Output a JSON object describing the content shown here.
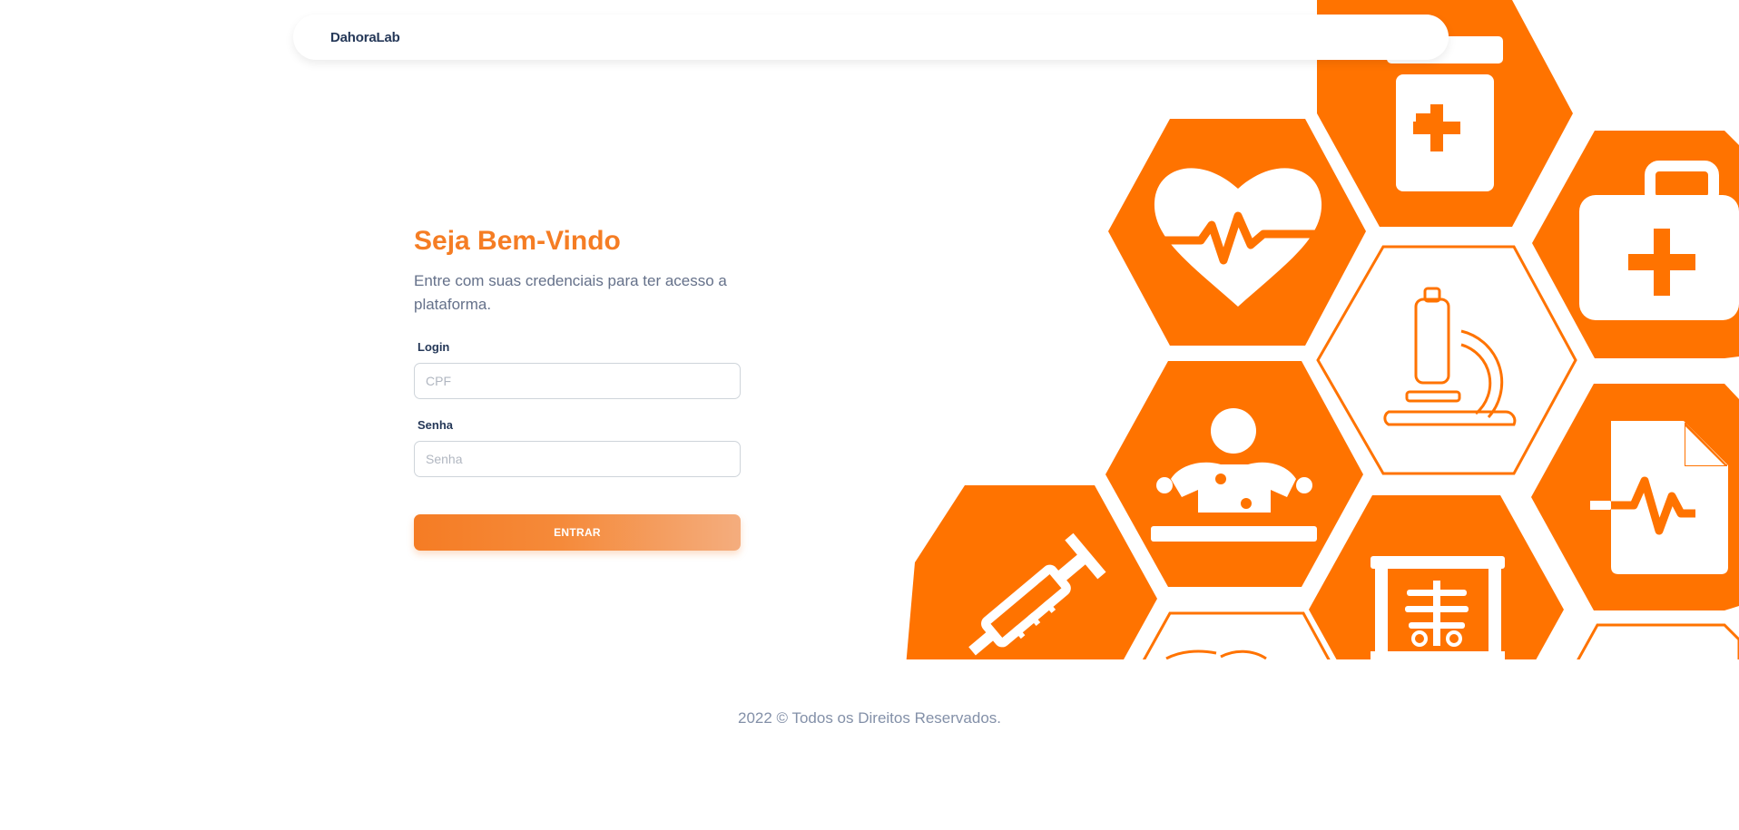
{
  "header": {
    "brand": "DahoraLab"
  },
  "login": {
    "title": "Seja Bem-Vindo",
    "subtitle": "Entre com suas credenciais para ter acesso a plataforma.",
    "login_label": "Login",
    "login_placeholder": "CPF",
    "password_label": "Senha",
    "password_placeholder": "Senha",
    "submit_label": "ENTRAR"
  },
  "footer": {
    "text": "2022 © Todos os Direitos Reservados."
  },
  "illustration": {
    "icons": [
      "heart-pulse-icon",
      "medicine-bottle-icon",
      "first-aid-kit-icon",
      "microscope-icon",
      "patient-bed-icon",
      "document-pulse-icon",
      "syringe-icon",
      "xray-icon"
    ]
  },
  "colors": {
    "accent": "#f57d24",
    "hex_fill": "#ff7300",
    "brand_text": "#253858"
  }
}
